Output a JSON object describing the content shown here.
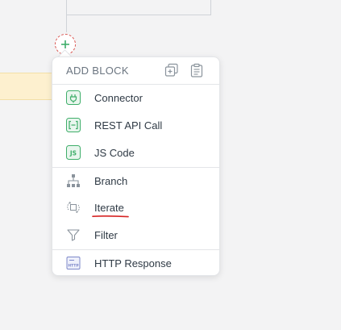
{
  "menu": {
    "title": "ADD BLOCK",
    "groups": [
      {
        "items": [
          {
            "label": "Connector",
            "icon": "plug-icon"
          },
          {
            "label": "REST API Call",
            "icon": "api-brackets-icon"
          },
          {
            "label": "JS Code",
            "icon": "js-code-icon"
          }
        ]
      },
      {
        "items": [
          {
            "label": "Branch",
            "icon": "branch-icon"
          },
          {
            "label": "Iterate",
            "icon": "iterate-icon"
          },
          {
            "label": "Filter",
            "icon": "filter-icon"
          }
        ]
      },
      {
        "items": [
          {
            "label": "HTTP Response",
            "icon": "http-response-icon"
          }
        ]
      }
    ]
  },
  "colors": {
    "accent_green": "#3fae6a",
    "add_button_border": "#d9534f",
    "underline_red": "#d62424"
  }
}
